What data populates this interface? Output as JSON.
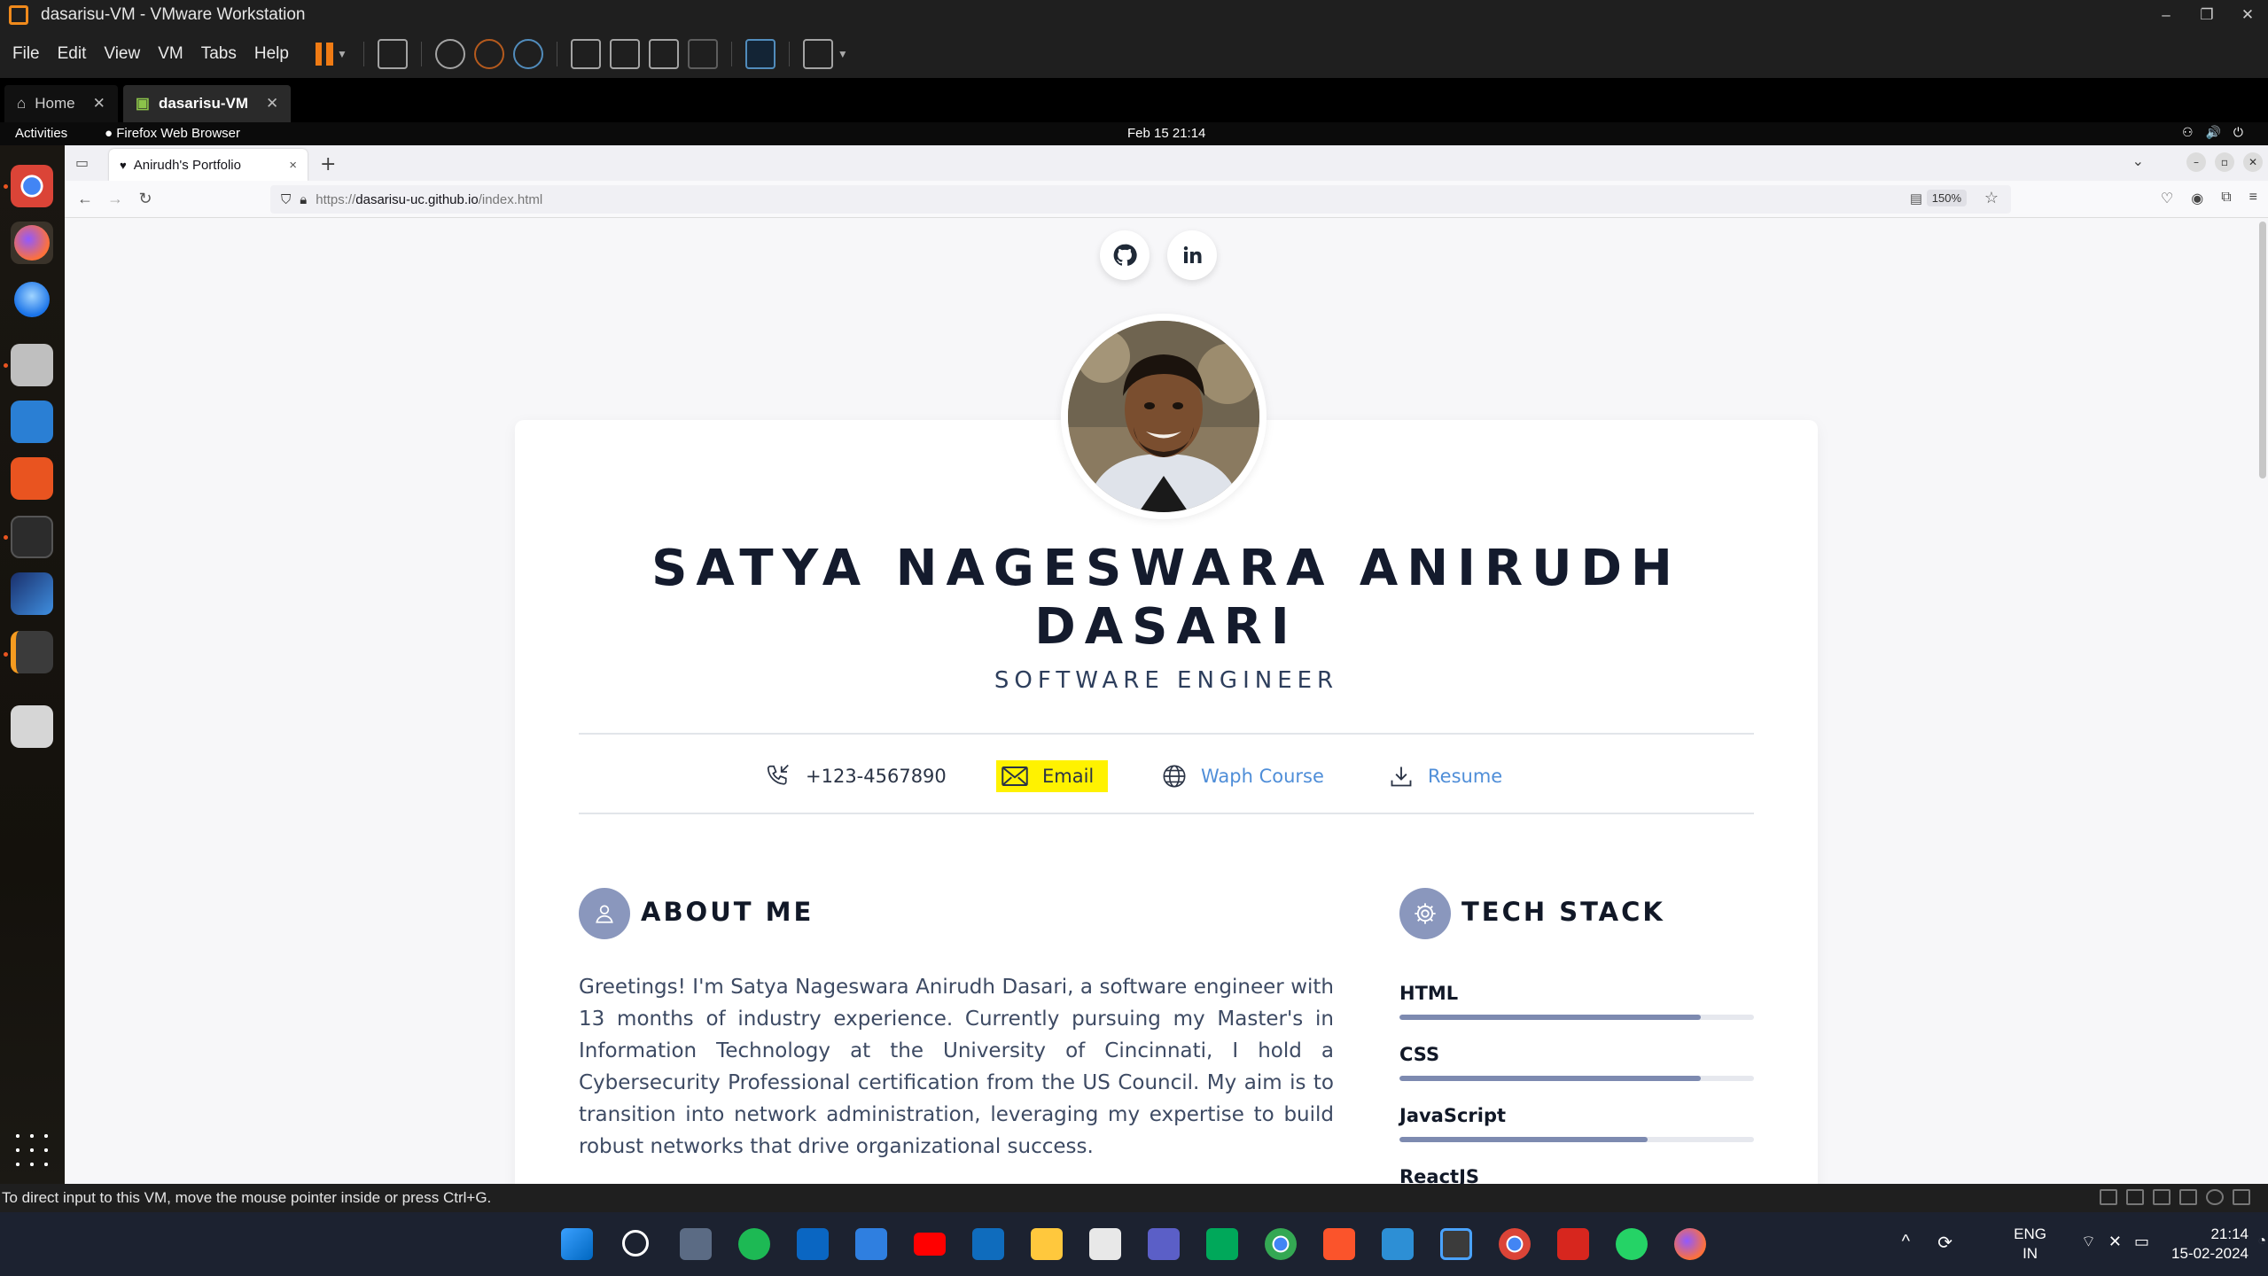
{
  "vmware": {
    "title": "dasarisu-VM - VMware Workstation",
    "window_controls": [
      "–",
      "❐",
      "✕"
    ],
    "menu": [
      "File",
      "Edit",
      "View",
      "VM",
      "Tabs",
      "Help"
    ],
    "tabs": [
      {
        "label": "Home",
        "active": false
      },
      {
        "label": "dasarisu-VM",
        "active": true
      }
    ],
    "status_text": "To direct input to this VM, move the mouse pointer inside or press Ctrl+G."
  },
  "gnome": {
    "activities": "Activities",
    "app_name": "Firefox Web Browser",
    "clock": "Feb 15  21:14",
    "sys_icons": "⚇🔊⏻"
  },
  "firefox": {
    "tab_title": "Anirudh's Portfolio",
    "tab_close": "×",
    "new_tab": "+",
    "url_prefix": "https://",
    "url_host": "dasarisu-uc.github.io",
    "url_path": "/index.html",
    "zoom": "150%"
  },
  "portfolio": {
    "name_line1": "SATYA NAGESWARA ANIRUDH",
    "name_line2": "DASARI",
    "role": "SOFTWARE ENGINEER",
    "contacts": {
      "phone": "+123-4567890",
      "email": "Email",
      "course": "Waph Course",
      "resume": "Resume"
    },
    "about": {
      "title": "ABOUT ME",
      "text": "Greetings! I'm Satya Nageswara Anirudh Dasari, a software engineer with 13 months of industry experience. Currently pursuing my Master's in Information Technology at the University of Cincinnati, I hold a Cybersecurity Professional certification from the US Council. My aim is to transition into network administration, leveraging my expertise to build robust networks that drive organizational success."
    },
    "tech": {
      "title": "TECH STACK",
      "skills": [
        {
          "label": "HTML",
          "level": 0.85
        },
        {
          "label": "CSS",
          "level": 0.85
        },
        {
          "label": "JavaScript",
          "level": 0.7
        },
        {
          "label": "ReactJS"
        }
      ]
    }
  },
  "taskbar": {
    "lang_line1": "ENG",
    "lang_line2": "IN",
    "time": "21:14",
    "date": "15-02-2024"
  },
  "colors": {
    "vmware_bg": "#1f1f1f",
    "accent_orange": "#f07b14",
    "link_blue": "#4f8ed8",
    "highlight_yellow": "#fff200",
    "icon_circle": "#8a97bd"
  }
}
